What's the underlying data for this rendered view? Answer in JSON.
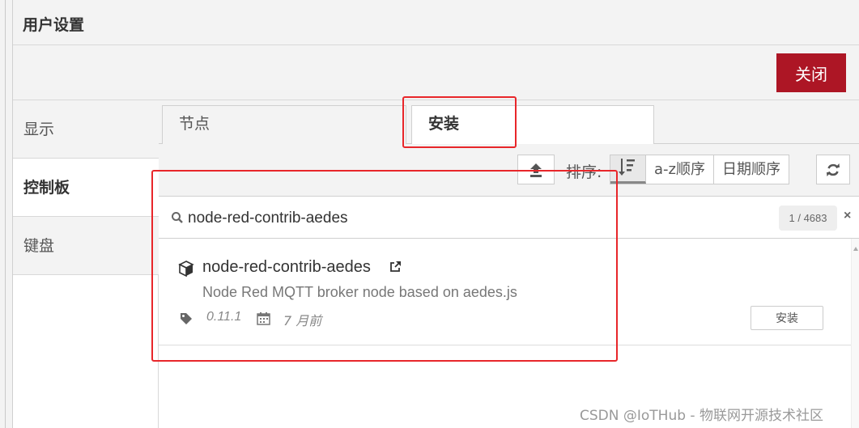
{
  "header": {
    "title": "用户设置"
  },
  "toolbar": {
    "close_label": "关闭"
  },
  "sidebar": {
    "items": [
      {
        "label": "显示"
      },
      {
        "label": "控制板"
      },
      {
        "label": "键盘"
      }
    ]
  },
  "tabs": [
    {
      "label": "节点"
    },
    {
      "label": "安装"
    }
  ],
  "sort": {
    "label": "排序:",
    "options": [
      "a-z顺序",
      "日期顺序"
    ]
  },
  "search": {
    "value": "node-red-contrib-aedes",
    "count": "1 / 4683",
    "clear": "×"
  },
  "result": {
    "name": "node-red-contrib-aedes",
    "description": "Node Red MQTT broker node based on aedes.js",
    "version": "0.11.1",
    "updated": "7 月前",
    "install_label": "安装"
  },
  "watermark": "CSDN @IoTHub - 物联网开源技术社区",
  "colors": {
    "close_button": "#ad1625",
    "highlight": "#e8262a"
  }
}
